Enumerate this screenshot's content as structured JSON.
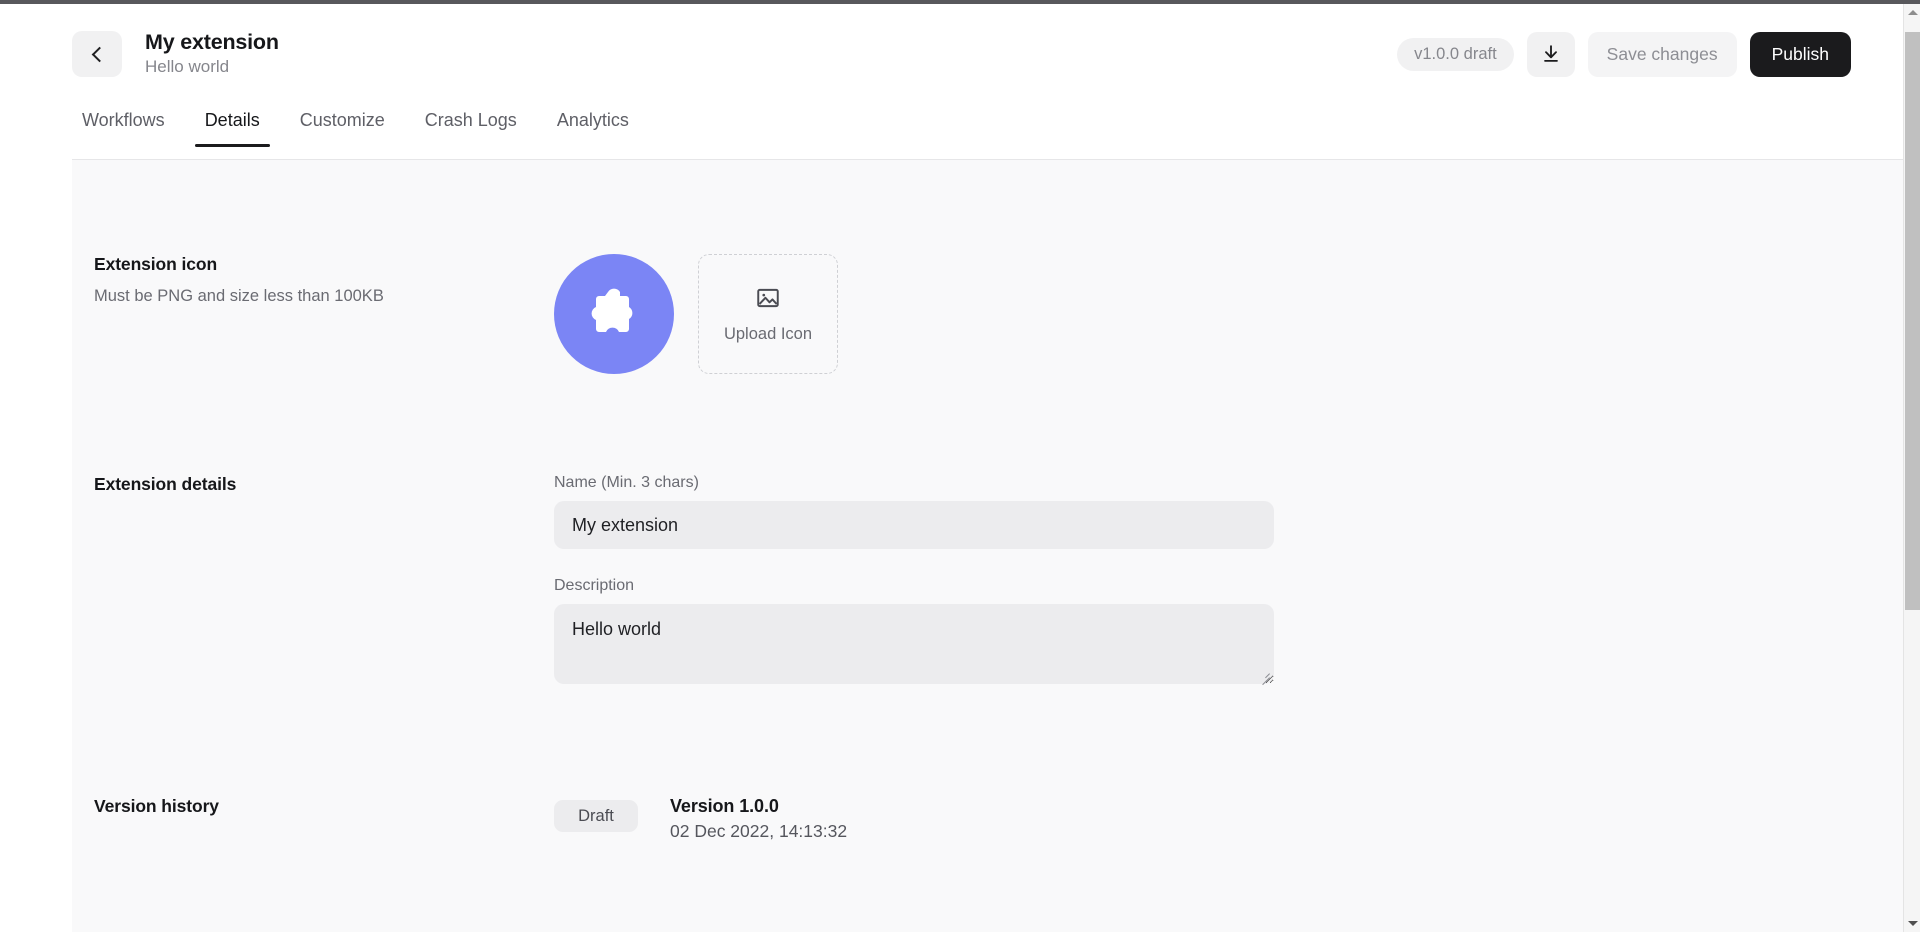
{
  "header": {
    "back_icon": "chevron-left-icon",
    "title": "My extension",
    "subtitle": "Hello world",
    "version_chip": "v1.0.0 draft",
    "download_icon": "download-icon",
    "save_label": "Save changes",
    "publish_label": "Publish"
  },
  "tabs": [
    {
      "label": "Workflows",
      "active": false
    },
    {
      "label": "Details",
      "active": true
    },
    {
      "label": "Customize",
      "active": false
    },
    {
      "label": "Crash Logs",
      "active": false
    },
    {
      "label": "Analytics",
      "active": false
    }
  ],
  "sections": {
    "icon": {
      "title": "Extension icon",
      "description": "Must be PNG and size less than 100KB",
      "current_icon": "puzzle-piece-icon",
      "icon_color": "#7b85f5",
      "upload": {
        "icon": "image-placeholder-icon",
        "label": "Upload Icon"
      }
    },
    "details": {
      "title": "Extension details",
      "fields": [
        {
          "label": "Name (Min. 3 chars)",
          "value": "My extension",
          "placeholder": "Name"
        },
        {
          "label": "Description",
          "value": "Hello world",
          "placeholder": "Description"
        }
      ]
    },
    "version": {
      "title": "Version history",
      "entries": [
        {
          "badge": "Draft",
          "name": "Version 1.0.0",
          "date": "02 Dec 2022, 14:13:32"
        }
      ]
    }
  },
  "scrollbar": {
    "up_icon": "scroll-up-arrow-icon",
    "down_icon": "scroll-down-arrow-icon"
  },
  "colors": {
    "accent": "#7b85f5",
    "publish_bg": "#1b1b1d",
    "field_bg": "#ececee",
    "page_bg": "#f9f9fa"
  }
}
